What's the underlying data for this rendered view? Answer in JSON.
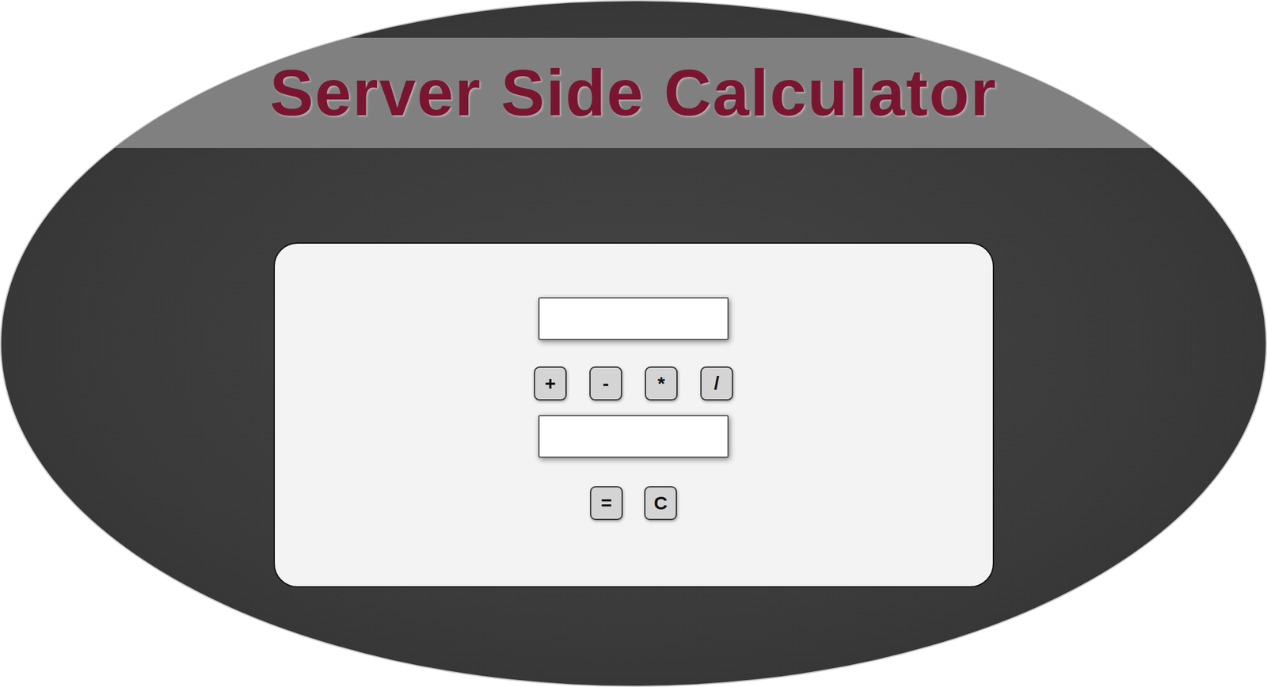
{
  "title": "Server Side Calculator",
  "inputs": [
    {
      "value": ""
    },
    {
      "value": ""
    }
  ],
  "operators": [
    "+",
    "-",
    "*",
    "/"
  ],
  "actions": [
    "=",
    "C"
  ]
}
